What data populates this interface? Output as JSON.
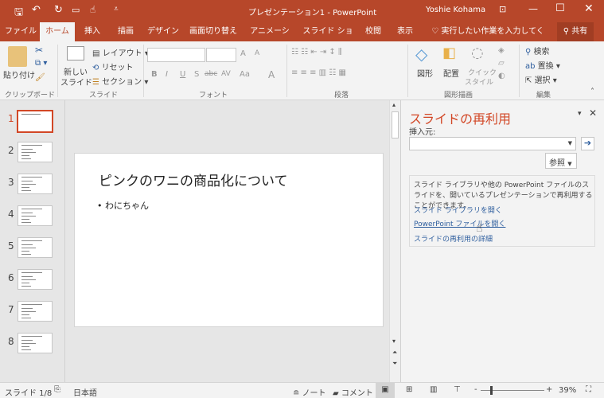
{
  "title_bar": {
    "title": "プレゼンテーション1 - PowerPoint",
    "user": "Yoshie Kohama",
    "icons": [
      "save-icon",
      "undo-icon",
      "redo-icon",
      "present-icon",
      "touch-mode-icon",
      "customize-icon"
    ],
    "accent": "#b7472a"
  },
  "tabs": [
    {
      "label": "ファイル"
    },
    {
      "label": "ホーム",
      "active": true
    },
    {
      "label": "挿入"
    },
    {
      "label": "描画"
    },
    {
      "label": "デザイン"
    },
    {
      "label": "画面切り替え"
    },
    {
      "label": "アニメーション"
    },
    {
      "label": "スライド ショー"
    },
    {
      "label": "校閲"
    },
    {
      "label": "表示"
    }
  ],
  "tell_me": "実行したい作業を入力してください",
  "share": "共有",
  "ribbon": {
    "clipboard": {
      "paste": "貼り付け",
      "group": "クリップボード"
    },
    "slides": {
      "new_slide_1": "新しい",
      "new_slide_2": "スライド",
      "layout": "レイアウト",
      "reset": "リセット",
      "section": "セクション",
      "group": "スライド"
    },
    "font": {
      "bold": "B",
      "italic": "I",
      "underline": "U",
      "shadow": "S",
      "strike": "abc",
      "spacing": "AV",
      "case": "Aa",
      "color": "A",
      "grow": "A",
      "shrink": "A",
      "group": "フォント"
    },
    "paragraph": {
      "group": "段落"
    },
    "drawing": {
      "shapes": "図形",
      "arrange": "配置",
      "quick_1": "クイック",
      "quick_2": "スタイル",
      "group": "図形描画"
    },
    "editing": {
      "find": "検索",
      "replace": "置換",
      "select": "選択",
      "group": "編集"
    }
  },
  "thumbnails": [
    "1",
    "2",
    "3",
    "4",
    "5",
    "6",
    "7",
    "8"
  ],
  "slide": {
    "title": "ピンクのワニの商品化について",
    "bullet": "• わにちゃん"
  },
  "reuse_pane": {
    "title": "スライドの再利用",
    "insert_from": "挿入元:",
    "input_value": "",
    "browse": "参照",
    "description": "スライド ライブラリや他の PowerPoint ファイルのスライドを、開いているプレゼンテーションで再利用することができます。",
    "link_library": "スライド ライブラリを開く",
    "link_file": "PowerPoint ファイルを開く",
    "link_more": "スライドの再利用の詳細"
  },
  "status": {
    "slide": "スライド 1/8",
    "language": "日本語",
    "notes": "ノート",
    "comments": "コメント",
    "zoom": "39%",
    "zoom_value": 39
  }
}
